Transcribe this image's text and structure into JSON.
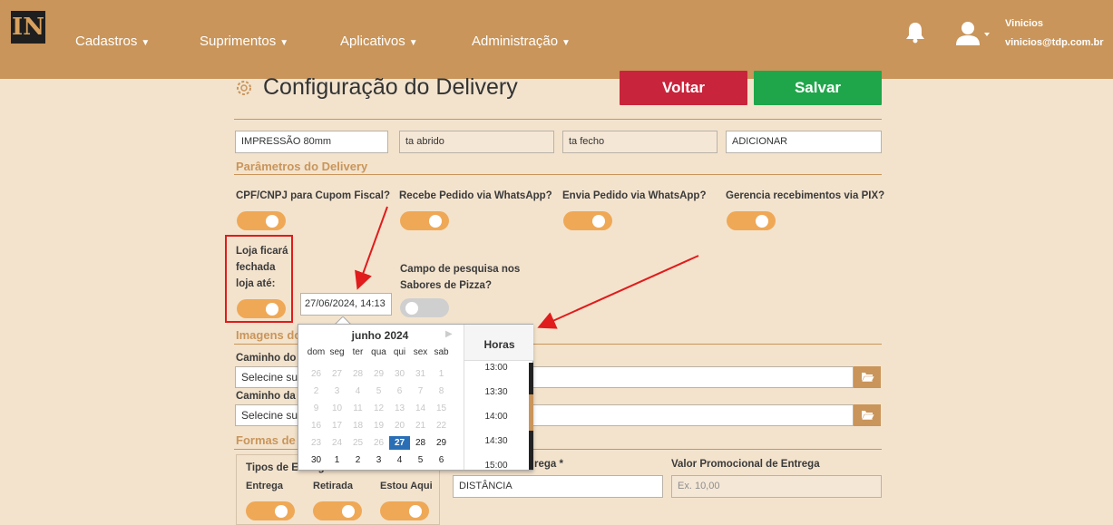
{
  "app": {
    "logo_text": "IN",
    "nav": [
      {
        "label": "Cadastros"
      },
      {
        "label": "Suprimentos"
      },
      {
        "label": "Aplicativos"
      },
      {
        "label": "Administração"
      }
    ],
    "user": {
      "name": "Vinicios",
      "email": "vinicios@tdp.com.br"
    },
    "icons": {
      "bell": "bell-icon",
      "user": "user-icon",
      "gear": "gear-icon",
      "folder": "folder-open-icon"
    },
    "colors": {
      "nav": "#c9955a",
      "page_bg": "#f3e3cd",
      "toggle_on": "#efa856",
      "voltar": "#c8243b",
      "salvar": "#1fa64a",
      "highlight": "#e01c1c"
    }
  },
  "page": {
    "title": "Configuração do Delivery",
    "voltar_label": "Voltar",
    "salvar_label": "Salvar"
  },
  "top_fields": {
    "impressao": "IMPRESSÃO 80mm",
    "aberto": "ta abrido",
    "fecho": "ta fecho",
    "adicionar": "ADICIONAR"
  },
  "params": {
    "section_title": "Parâmetros do Delivery",
    "labels": [
      "CPF/CNPJ para Cupom Fiscal?",
      "Recebe Pedido via WhatsApp?",
      "Envia Pedido via WhatsApp?",
      "Gerencia recebimentos via PIX?"
    ],
    "loja_fechada_lines": [
      "Loja ficará",
      "fechada",
      "loja até:"
    ],
    "loja_fechada_value": "27/06/2024, 14:13",
    "campo_pesquisa_lines": [
      "Campo de pesquisa nos",
      "Sabores de Pizza?"
    ]
  },
  "images": {
    "section_title": "Imagens do",
    "caminho1_label": "Caminho do",
    "caminho1_value": "Selecine su",
    "caminho2_label": "Caminho da",
    "caminho2_value": "Selecine su"
  },
  "formas": {
    "section_title": "Formas de",
    "tipos_title": "Tipos de Entrega",
    "entrega": "Entrega",
    "retirada": "Retirada",
    "estou_aqui": "Estou Aqui",
    "entrega_field_label": "rega *",
    "entrega_field_value": "DISTÂNCIA",
    "valor_promo_label": "Valor Promocional de Entrega",
    "valor_promo_placeholder": "Ex. 10,00"
  },
  "picker": {
    "month": "junho 2024",
    "dow": [
      "dom",
      "seg",
      "ter",
      "qua",
      "qui",
      "sex",
      "sab"
    ],
    "weeks": [
      [
        "26",
        "27",
        "28",
        "29",
        "30",
        "31",
        "1"
      ],
      [
        "2",
        "3",
        "4",
        "5",
        "6",
        "7",
        "8"
      ],
      [
        "9",
        "10",
        "11",
        "12",
        "13",
        "14",
        "15"
      ],
      [
        "16",
        "17",
        "18",
        "19",
        "20",
        "21",
        "22"
      ],
      [
        "23",
        "24",
        "25",
        "26",
        "27",
        "28",
        "29"
      ],
      [
        "30",
        "1",
        "2",
        "3",
        "4",
        "5",
        "6"
      ]
    ],
    "selected_day": "27",
    "hours_title": "Horas",
    "hours": [
      "13:00",
      "13:30",
      "14:00",
      "14:30",
      "15:00"
    ]
  }
}
